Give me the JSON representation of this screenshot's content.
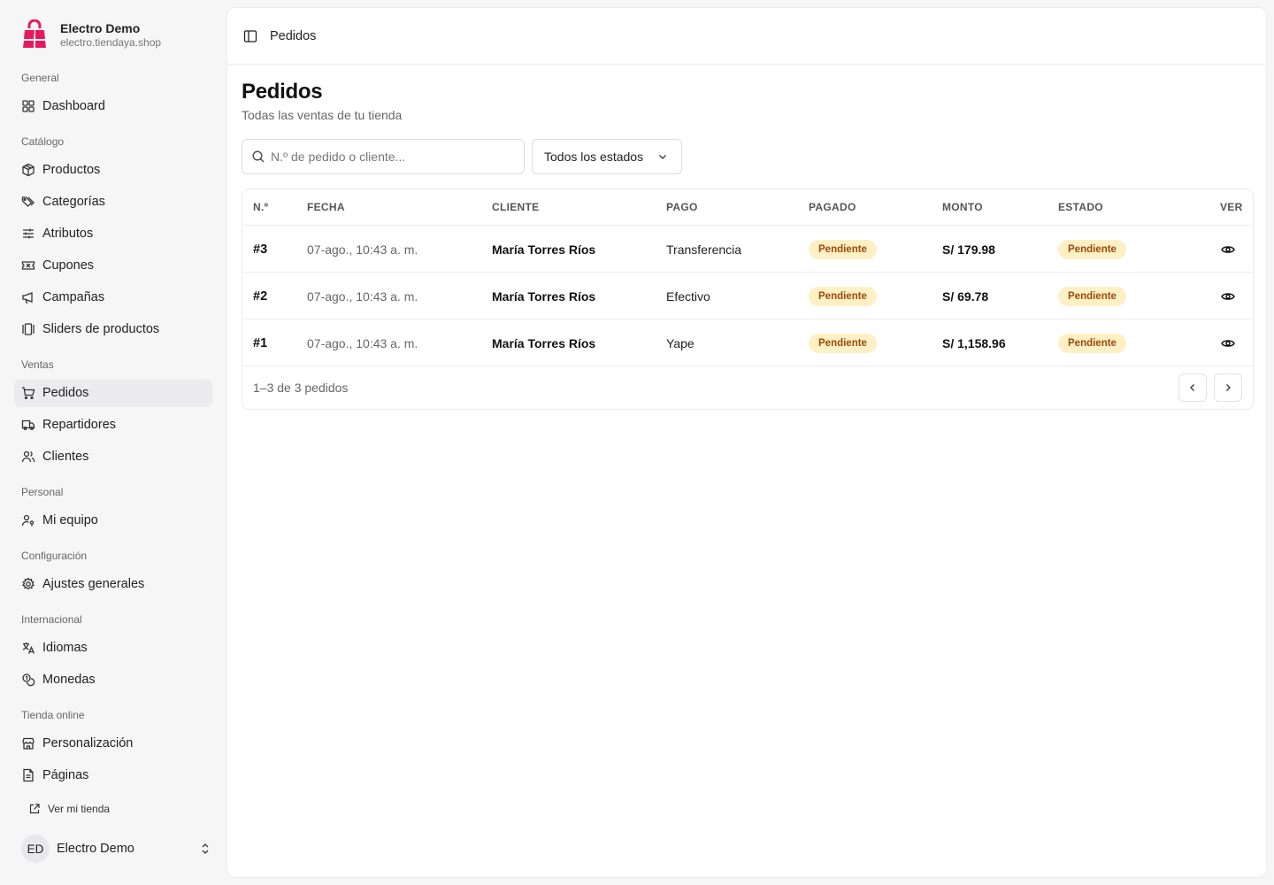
{
  "brand": {
    "name": "Electro Demo",
    "url": "electro.tiendaya.shop",
    "accent": "#e6195f"
  },
  "nav": {
    "groups": [
      {
        "label": "General",
        "items": [
          {
            "label": "Dashboard",
            "icon": "grid-icon"
          }
        ]
      },
      {
        "label": "Catálogo",
        "items": [
          {
            "label": "Productos",
            "icon": "box-icon"
          },
          {
            "label": "Categorías",
            "icon": "tags-icon"
          },
          {
            "label": "Atributos",
            "icon": "sliders-icon"
          },
          {
            "label": "Cupones",
            "icon": "ticket-icon"
          },
          {
            "label": "Campañas",
            "icon": "megaphone-icon"
          },
          {
            "label": "Sliders de productos",
            "icon": "gallery-icon"
          }
        ]
      },
      {
        "label": "Ventas",
        "items": [
          {
            "label": "Pedidos",
            "icon": "cart-icon",
            "active": true
          },
          {
            "label": "Repartidores",
            "icon": "truck-icon"
          },
          {
            "label": "Clientes",
            "icon": "users-icon"
          }
        ]
      },
      {
        "label": "Personal",
        "items": [
          {
            "label": "Mi equipo",
            "icon": "user-key-icon"
          }
        ]
      },
      {
        "label": "Configuración",
        "items": [
          {
            "label": "Ajustes generales",
            "icon": "gear-icon"
          }
        ]
      },
      {
        "label": "Internacional",
        "items": [
          {
            "label": "Idiomas",
            "icon": "translate-icon"
          },
          {
            "label": "Monedas",
            "icon": "coins-icon"
          }
        ]
      },
      {
        "label": "Tienda online",
        "items": [
          {
            "label": "Personalización",
            "icon": "store-icon"
          },
          {
            "label": "Páginas",
            "icon": "file-icon"
          }
        ]
      }
    ],
    "view_store": "Ver mi tienda"
  },
  "user": {
    "initials": "ED",
    "name": "Electro Demo"
  },
  "header": {
    "breadcrumb": "Pedidos"
  },
  "page": {
    "title": "Pedidos",
    "subtitle": "Todas las ventas de tu tienda"
  },
  "filters": {
    "search_placeholder": "N.º de pedido o cliente...",
    "status_selected": "Todos los estados"
  },
  "table": {
    "columns": [
      "N.º",
      "FECHA",
      "CLIENTE",
      "PAGO",
      "PAGADO",
      "MONTO",
      "ESTADO",
      "VER"
    ],
    "rows": [
      {
        "id": "#3",
        "date": "07-ago., 10:43 a. m.",
        "client": "María Torres Ríos",
        "payment": "Transferencia",
        "paid": "Pendiente",
        "amount": "S/ 179.98",
        "status": "Pendiente"
      },
      {
        "id": "#2",
        "date": "07-ago., 10:43 a. m.",
        "client": "María Torres Ríos",
        "payment": "Efectivo",
        "paid": "Pendiente",
        "amount": "S/ 69.78",
        "status": "Pendiente"
      },
      {
        "id": "#1",
        "date": "07-ago., 10:43 a. m.",
        "client": "María Torres Ríos",
        "payment": "Yape",
        "paid": "Pendiente",
        "amount": "S/ 1,158.96",
        "status": "Pendiente"
      }
    ],
    "footer": "1–3 de 3 pedidos"
  },
  "colors": {
    "badge_bg": "#fdf0c4",
    "badge_text": "#9a4a0a",
    "active_nav_bg": "#ececee"
  }
}
